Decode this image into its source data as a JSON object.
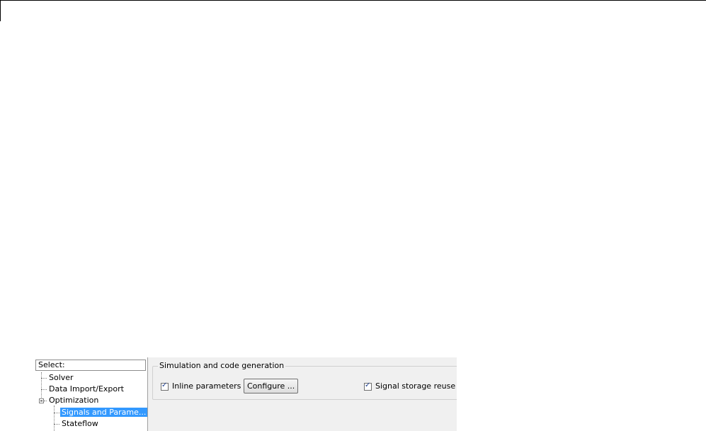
{
  "tree": {
    "header": "Select:",
    "items": [
      {
        "label": "Solver"
      },
      {
        "label": "Data Import/Export"
      },
      {
        "label": "Optimization"
      },
      {
        "label": "Signals and Parame..."
      },
      {
        "label": "Stateflow"
      }
    ],
    "selected_index": 3
  },
  "panel": {
    "group_title": "Simulation and code generation",
    "inline_parameters": {
      "label": "Inline parameters",
      "checked": true
    },
    "configure_button": "Configure ...",
    "signal_storage_reuse": {
      "label": "Signal storage reuse",
      "checked": true
    }
  },
  "icons": {
    "check": "checkmark-icon",
    "tree_collapse": "minus-expander-icon"
  },
  "colors": {
    "selection": "#3399ff",
    "panel_bg": "#f0f0f0"
  }
}
